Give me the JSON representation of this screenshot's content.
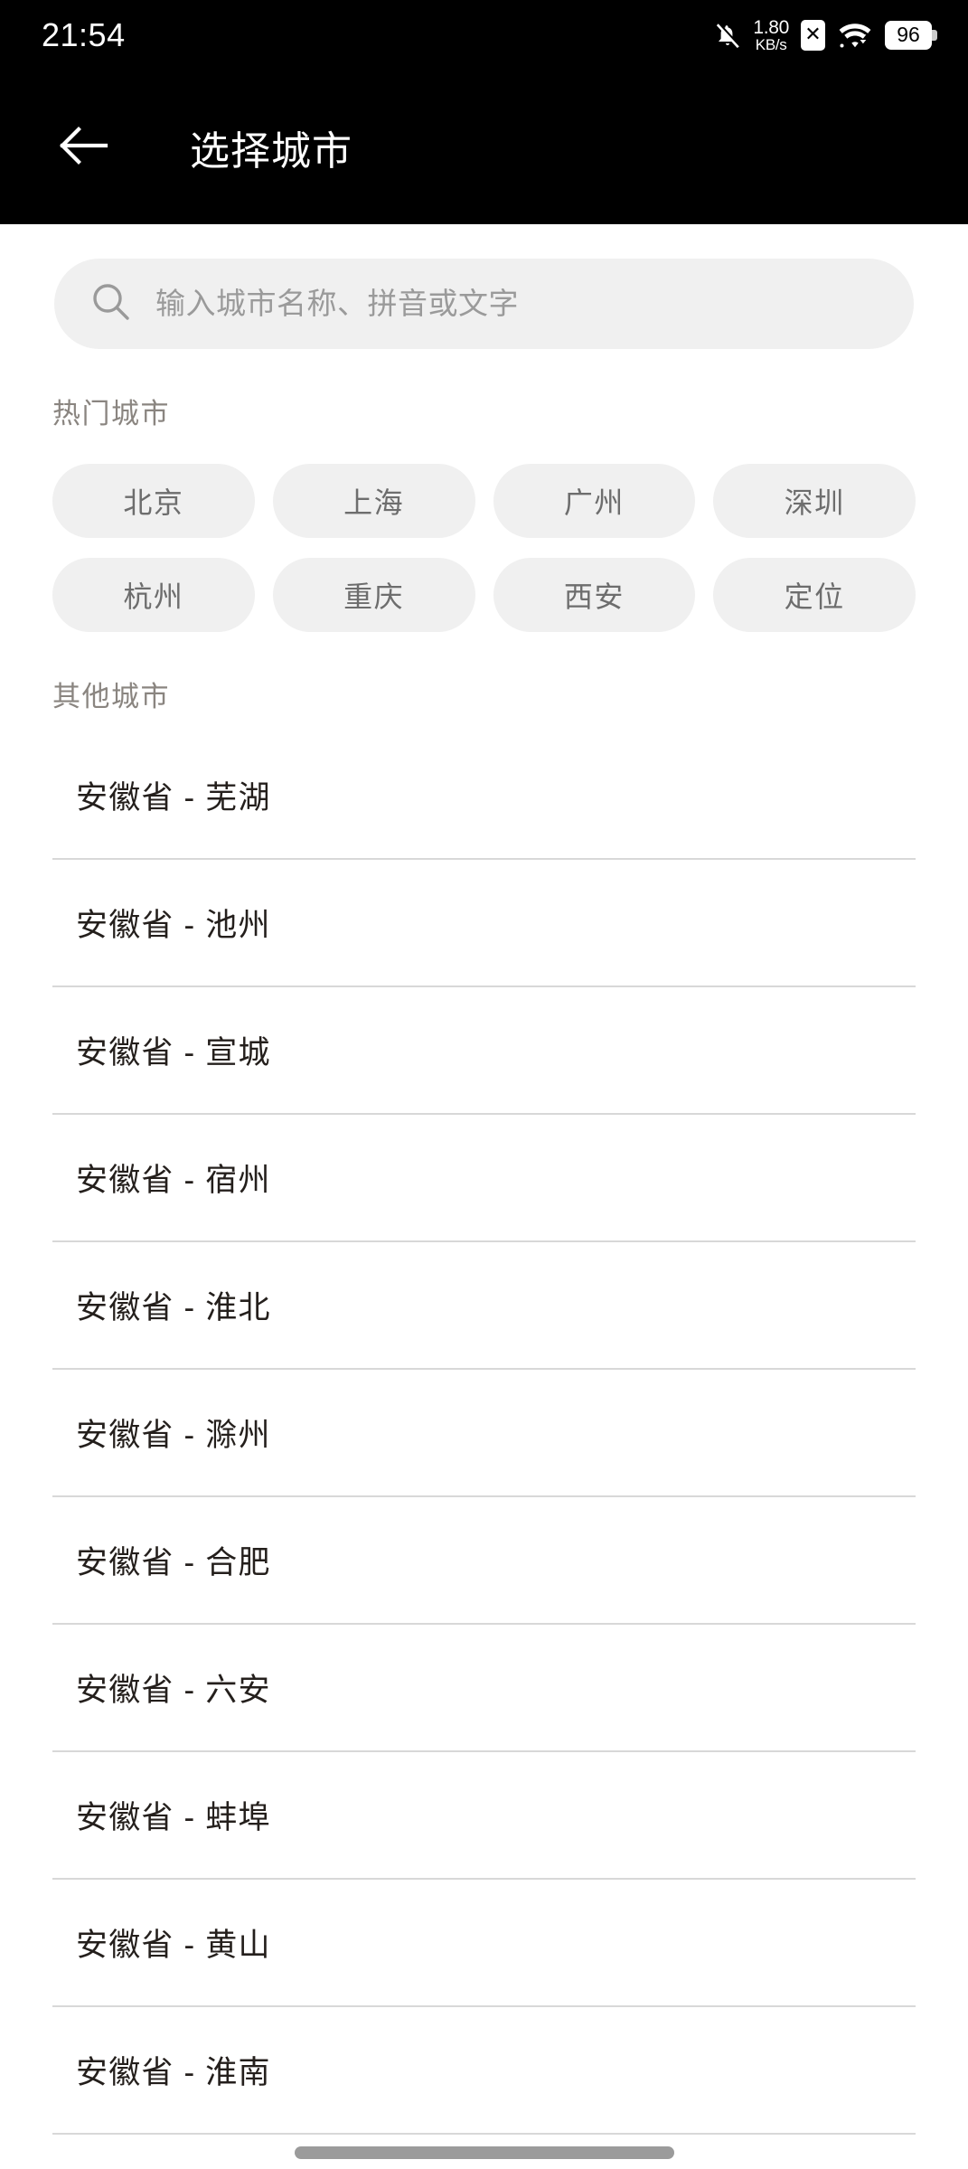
{
  "status_bar": {
    "time": "21:54",
    "network_speed_value": "1.80",
    "network_speed_unit": "KB/s",
    "battery_level": "96",
    "sim_badge": "✕",
    "icons": {
      "bell": "bell-mute-icon",
      "sim": "sim-card-disabled-icon",
      "wifi": "wifi-icon",
      "battery": "battery-icon"
    }
  },
  "app_bar": {
    "back_icon": "back-arrow-icon",
    "title": "选择城市"
  },
  "search": {
    "icon": "search-icon",
    "placeholder": "输入城市名称、拼音或文字",
    "value": ""
  },
  "hot_cities": {
    "title": "热门城市",
    "items": [
      {
        "label": "北京"
      },
      {
        "label": "上海"
      },
      {
        "label": "广州"
      },
      {
        "label": "深圳"
      },
      {
        "label": "杭州"
      },
      {
        "label": "重庆"
      },
      {
        "label": "西安"
      },
      {
        "label": "定位"
      }
    ]
  },
  "other_cities": {
    "title": "其他城市",
    "items": [
      {
        "label": "安徽省 - 芜湖"
      },
      {
        "label": "安徽省 - 池州"
      },
      {
        "label": "安徽省 - 宣城"
      },
      {
        "label": "安徽省 - 宿州"
      },
      {
        "label": "安徽省 - 淮北"
      },
      {
        "label": "安徽省 - 滁州"
      },
      {
        "label": "安徽省 - 合肥"
      },
      {
        "label": "安徽省 - 六安"
      },
      {
        "label": "安徽省 - 蚌埠"
      },
      {
        "label": "安徽省 - 黄山"
      },
      {
        "label": "安徽省 - 淮南"
      }
    ]
  },
  "nav_bar": {
    "handle": "home-gesture-handle"
  },
  "colors": {
    "app_bar_bg": "#000000",
    "page_bg": "#ffffff",
    "chip_bg": "#f0f0f0",
    "chip_text": "#6d6d6d",
    "section_title": "#8a8580",
    "list_text": "#241f1c",
    "divider": "#d8d8d8",
    "placeholder": "#9a9a9a"
  }
}
